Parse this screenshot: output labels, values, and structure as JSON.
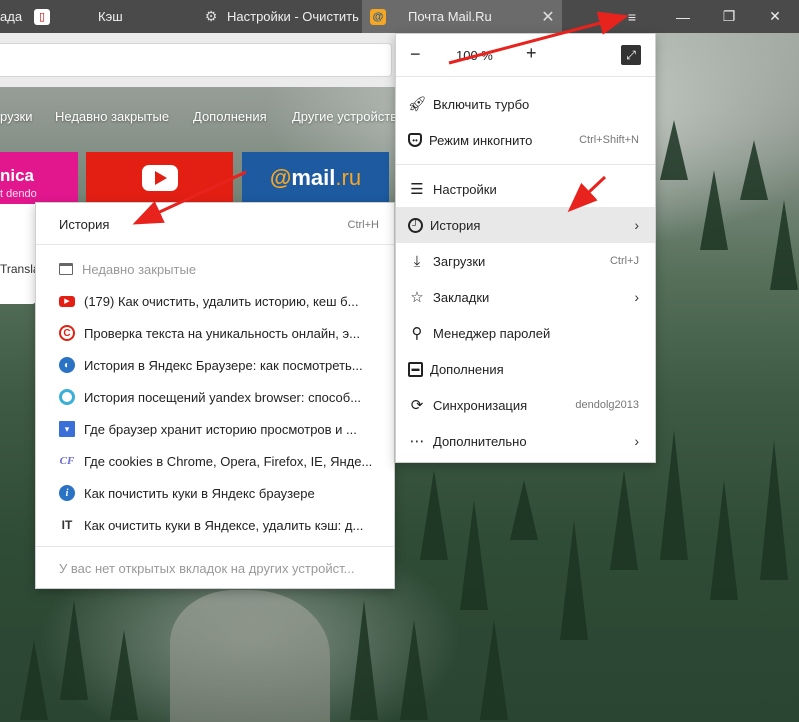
{
  "tabs": [
    {
      "label": "ада",
      "icon": "",
      "active": false
    },
    {
      "label": "Кэш",
      "icon": "bookmark-favicon",
      "active": false
    },
    {
      "label": "Настройки - Очистить",
      "icon": "gear-icon",
      "active": false
    },
    {
      "label": "Почта Mail.Ru",
      "icon": "mail-favicon",
      "active": true
    }
  ],
  "window_controls": {
    "menu": "≡",
    "minimize": "—",
    "restore": "❐",
    "close": "✕"
  },
  "newtab_menu": [
    "рузки",
    "Недавно закрытые",
    "Дополнения",
    "Другие устройств"
  ],
  "tiles": [
    {
      "label": "nica",
      "sub": "t dendo",
      "color": "#e2178e"
    },
    {
      "label": "YouTube",
      "color": "#e31f14"
    },
    {
      "label_at": "@",
      "label_mail": "mail",
      "label_ru": ".ru",
      "color": "#1d5aa0"
    }
  ],
  "tile_sub_text": "Transla",
  "history_menu": {
    "title": "История",
    "shortcut": "Ctrl+H",
    "recent_label": "Недавно закрытые",
    "items": [
      {
        "text": "(179) Как очистить, удалить историю, кеш б...",
        "icon": "youtube-favicon"
      },
      {
        "text": "Проверка текста на уникальность онлайн, э...",
        "icon": "copyright-favicon"
      },
      {
        "text": "История в Яндекс Браузере: как посмотреть...",
        "icon": "globe-favicon"
      },
      {
        "text": "История посещений yandex browser: способ...",
        "icon": "ring-favicon"
      },
      {
        "text": "Где браузер хранит историю просмотров и ...",
        "icon": "bookmark-favicon"
      },
      {
        "text": "Где cookies в Chrome, Opera, Firefox, IE, Янде...",
        "icon": "cf-favicon"
      },
      {
        "text": "Как почистить куки в Яндекс браузере",
        "icon": "info-favicon"
      },
      {
        "text": "Как очистить куки в Яндексе, удалить кэш: д...",
        "icon": "it-favicon"
      }
    ],
    "footer": "У вас нет открытых вкладок на других устройст..."
  },
  "main_menu": {
    "zoom": {
      "minus": "−",
      "value": "100 %",
      "plus": "+",
      "fullscreen_icon": "fullscreen-icon"
    },
    "items": [
      {
        "label": "Включить турбо",
        "icon": "rocket-icon",
        "shortcut": "",
        "arrow": false
      },
      {
        "label": "Режим инкогнито",
        "icon": "incognito-icon",
        "shortcut": "Ctrl+Shift+N",
        "arrow": false
      },
      {
        "label": "Настройки",
        "icon": "settings-sliders-icon",
        "shortcut": "",
        "arrow": false
      },
      {
        "label": "История",
        "icon": "clock-icon",
        "shortcut": "",
        "arrow": true
      },
      {
        "label": "Загрузки",
        "icon": "download-icon",
        "shortcut": "Ctrl+J",
        "arrow": false
      },
      {
        "label": "Закладки",
        "icon": "star-icon",
        "shortcut": "",
        "arrow": true
      },
      {
        "label": "Менеджер паролей",
        "icon": "key-icon",
        "shortcut": "",
        "arrow": false
      },
      {
        "label": "Дополнения",
        "icon": "extensions-icon",
        "shortcut": "",
        "arrow": false
      },
      {
        "label": "Синхронизация",
        "icon": "sync-icon",
        "shortcut": "dendolg2013",
        "arrow": false
      },
      {
        "label": "Дополнительно",
        "icon": "more-icon",
        "shortcut": "",
        "arrow": true
      }
    ]
  },
  "colors": {
    "annotation_arrow": "#e8231d",
    "highlight": "#e8e8e8",
    "tab_bar": "#4a4a4a"
  }
}
